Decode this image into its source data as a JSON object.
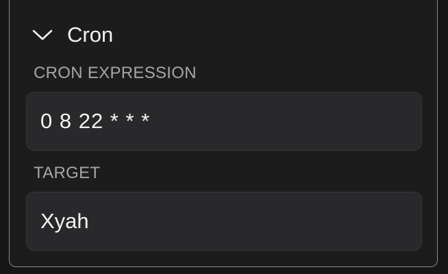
{
  "section": {
    "title": "Cron",
    "expanded": true,
    "toggle_icon": "chevron-down-icon"
  },
  "fields": {
    "cron_expression": {
      "label": "CRON EXPRESSION",
      "value": "0 8 22 * * *"
    },
    "target": {
      "label": "TARGET",
      "value": "Xyah"
    }
  },
  "colors": {
    "background": "#161616",
    "panel": "#1c1c1c",
    "panel_border": "#8b8b8b",
    "field_background": "#29292b",
    "label": "#a6a6a6",
    "text": "#f2f2f2"
  }
}
